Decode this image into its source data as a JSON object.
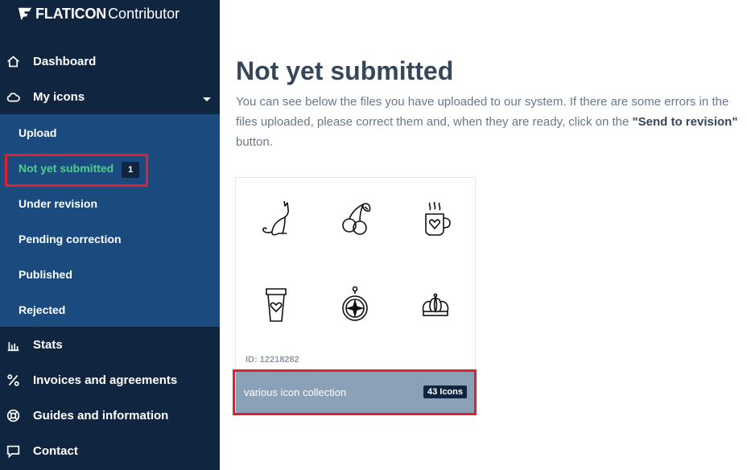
{
  "brand": {
    "name": "FLATICON",
    "product": "Contributor"
  },
  "sidebar": {
    "items": [
      {
        "label": "Dashboard",
        "icon": "home-icon"
      },
      {
        "label": "My icons",
        "icon": "cloud-icon"
      },
      {
        "label": "Stats",
        "icon": "bar-chart-icon"
      },
      {
        "label": "Invoices and agreements",
        "icon": "percent-icon"
      },
      {
        "label": "Guides and information",
        "icon": "lifebuoy-icon"
      },
      {
        "label": "Contact",
        "icon": "chat-icon"
      }
    ],
    "submenu": [
      {
        "label": "Upload"
      },
      {
        "label": "Not yet submitted",
        "badge": "1"
      },
      {
        "label": "Under revision"
      },
      {
        "label": "Pending correction"
      },
      {
        "label": "Published"
      },
      {
        "label": "Rejected"
      }
    ]
  },
  "main": {
    "title": "Not yet submitted",
    "desc_pre": "You can see below the files you have uploaded to our system. If there are some errors in the files uploaded, please correct them and, when they are ready, click on the ",
    "desc_bold": "\"Send to revision\"",
    "desc_post": " button."
  },
  "card": {
    "id_text": "ID: 12218282",
    "name": "various icon collection",
    "count": "43 Icons",
    "icons": [
      "cat-icon",
      "cherry-icon",
      "mug-heart-icon",
      "coffee-cup-heart-icon",
      "compass-icon",
      "crown-icon"
    ]
  },
  "colors": {
    "sidebar": "#102540",
    "submenu": "#1a4a7e",
    "active": "#4cd18b",
    "highlight": "#e21e2f",
    "card_footer": "#8ba1b7"
  }
}
